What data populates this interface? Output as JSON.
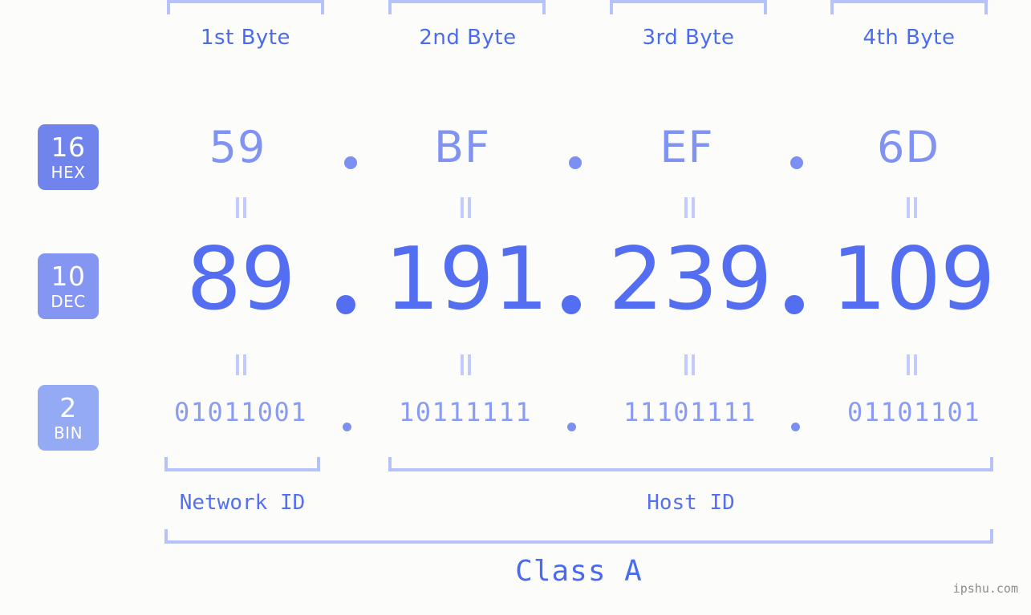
{
  "theme": {
    "background": "#fcfdfa",
    "accent_blue": "#546ef2",
    "header_blue": "#4a6bf0",
    "hex_blue": "#8193f2",
    "bin_blue": "#8a9bf4",
    "bracket_blue": "#b6c2fb",
    "badge_hex": "#7184ec",
    "badge_dec": "#8496f2",
    "badge_bin": "#94aaf5",
    "watermark_gray": "#8b8b8b"
  },
  "byte_headers": [
    {
      "label": "1st Byte"
    },
    {
      "label": "2nd Byte"
    },
    {
      "label": "3rd Byte"
    },
    {
      "label": "4th Byte"
    }
  ],
  "bases": [
    {
      "num": "16",
      "label": "HEX"
    },
    {
      "num": "10",
      "label": "DEC"
    },
    {
      "num": "2",
      "label": "BIN"
    }
  ],
  "separator": ".",
  "rows": {
    "hex": {
      "base": "16",
      "name": "HEX",
      "values": [
        "59",
        "BF",
        "EF",
        "6D"
      ]
    },
    "dec": {
      "base": "10",
      "name": "DEC",
      "values": [
        "89",
        "191",
        "239",
        "109"
      ]
    },
    "bin": {
      "base": "2",
      "name": "BIN",
      "values": [
        "01011001",
        "10111111",
        "11101111",
        "01101101"
      ]
    }
  },
  "ip_address": "89.191.239.109",
  "segments": {
    "network_id": "Network ID",
    "host_id": "Host ID",
    "class": "Class A"
  },
  "watermark": "ipshu.com"
}
